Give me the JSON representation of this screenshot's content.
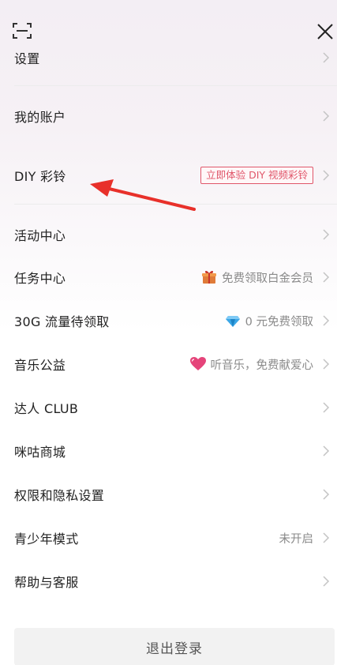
{
  "menu": [
    {
      "label": "设置"
    },
    {
      "label": "我的账户"
    },
    {
      "label": "DIY 彩铃",
      "promo": "立即体验 DIY 视频彩铃"
    },
    {
      "label": "活动中心"
    },
    {
      "label": "任务中心",
      "hint": "免费领取白金会员",
      "icon": "gift-icon"
    },
    {
      "label": "30G 流量待领取",
      "hint": "0 元免费领取",
      "icon": "diamond-icon"
    },
    {
      "label": "音乐公益",
      "hint": "听音乐，免费献爱心",
      "icon": "heart-icon"
    },
    {
      "label": "达人 CLUB"
    },
    {
      "label": "咪咕商城"
    },
    {
      "label": "权限和隐私设置"
    },
    {
      "label": "青少年模式",
      "hint": "未开启"
    },
    {
      "label": "帮助与客服"
    }
  ],
  "logout_label": "退出登录",
  "colors": {
    "accent": "#e0566a",
    "arrow": "#e8302a"
  }
}
